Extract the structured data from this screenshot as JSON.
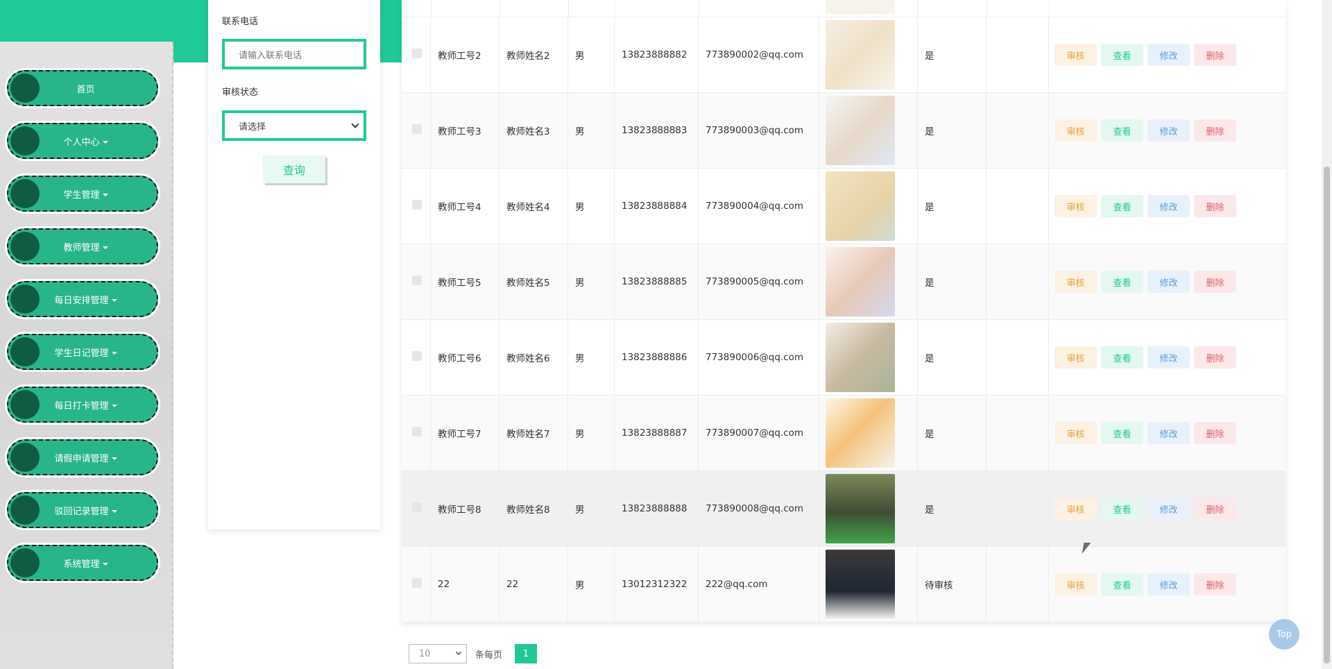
{
  "sidebar": {
    "items": [
      {
        "label": "首页",
        "has_caret": false
      },
      {
        "label": "个人中心",
        "has_caret": true
      },
      {
        "label": "学生管理",
        "has_caret": true
      },
      {
        "label": "教师管理",
        "has_caret": true
      },
      {
        "label": "每日安排管理",
        "has_caret": true
      },
      {
        "label": "学生日记管理",
        "has_caret": true
      },
      {
        "label": "每日打卡管理",
        "has_caret": true
      },
      {
        "label": "请假申请管理",
        "has_caret": true
      },
      {
        "label": "驳回记录管理",
        "has_caret": true
      },
      {
        "label": "系统管理",
        "has_caret": true
      }
    ]
  },
  "search": {
    "phone_label": "联系电话",
    "phone_placeholder": "请输入联系电话",
    "status_label": "审核状态",
    "status_selected": "请选择",
    "query_label": "查询"
  },
  "table": {
    "actions": {
      "audit": "审核",
      "view": "查看",
      "edit": "修改",
      "delete": "删除"
    },
    "rows": [
      {
        "id": "教师工号2",
        "name": "教师姓名2",
        "gender": "男",
        "phone": "13823888882",
        "email": "773890002@qq.com",
        "status": "是",
        "photo": "teacher-pointing-board"
      },
      {
        "id": "教师工号3",
        "name": "教师姓名3",
        "gender": "男",
        "phone": "13823888883",
        "email": "773890003@qq.com",
        "status": "是",
        "photo": "teacher-holding-book"
      },
      {
        "id": "教师工号4",
        "name": "教师姓名4",
        "gender": "男",
        "phone": "13823888884",
        "email": "773890004@qq.com",
        "status": "是",
        "photo": "teacher-reading"
      },
      {
        "id": "教师工号5",
        "name": "教师姓名5",
        "gender": "男",
        "phone": "13823888885",
        "email": "773890005@qq.com",
        "status": "是",
        "photo": "teacher-chart"
      },
      {
        "id": "教师工号6",
        "name": "教师姓名6",
        "gender": "男",
        "phone": "13823888886",
        "email": "773890006@qq.com",
        "status": "是",
        "photo": "teacher-students"
      },
      {
        "id": "教师工号7",
        "name": "教师姓名7",
        "gender": "男",
        "phone": "13823888887",
        "email": "773890007@qq.com",
        "status": "是",
        "photo": "teacher-pointer"
      },
      {
        "id": "教师工号8",
        "name": "教师姓名8",
        "gender": "男",
        "phone": "13823888888",
        "email": "773890008@qq.com",
        "status": "是",
        "photo": "classroom-photo"
      },
      {
        "id": "22",
        "name": "22",
        "gender": "男",
        "phone": "13012312322",
        "email": "222@qq.com",
        "status": "待审核",
        "photo": "man-in-suit"
      }
    ]
  },
  "pager": {
    "page_size": "10",
    "per_page_label": "条每页",
    "current_page": "1"
  },
  "top_button": "Top",
  "colors": {
    "brand": "#20c997",
    "sidebar_item": "#28b58a",
    "sidebar_dot": "#0f5c43"
  }
}
